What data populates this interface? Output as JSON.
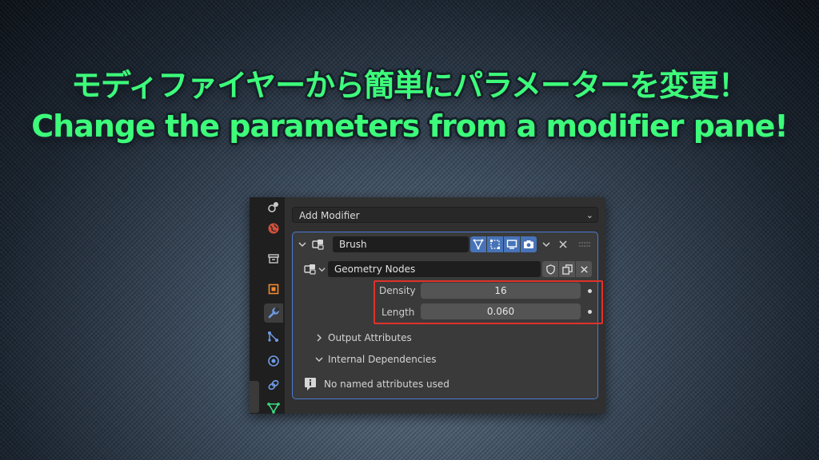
{
  "headline": {
    "jp": "モディファイヤーから簡単にパラメーターを変更！",
    "en": "Change the parameters from a modifier pane!"
  },
  "sidebar_tabs": [
    {
      "icon": "scene-data-icon",
      "color": "#c8c8c8"
    },
    {
      "icon": "world-icon",
      "color": "#e0543a"
    },
    {
      "icon": "collection-icon",
      "color": "#c8c8c8"
    },
    {
      "icon": "object-icon",
      "color": "#f0892f"
    },
    {
      "icon": "modifier-wrench-icon",
      "color": "#6f9be6",
      "active": true
    },
    {
      "icon": "particles-icon",
      "color": "#6f9be6"
    },
    {
      "icon": "physics-icon",
      "color": "#6f9be6"
    },
    {
      "icon": "constraints-icon",
      "color": "#6f9be6"
    },
    {
      "icon": "object-data-icon",
      "color": "#3ddc84"
    }
  ],
  "add_modifier": {
    "label": "Add Modifier"
  },
  "modifier": {
    "name": "Brush",
    "node_group": "Geometry Nodes",
    "inputs": [
      {
        "label": "Density",
        "value": "16"
      },
      {
        "label": "Length",
        "value": "0.060"
      }
    ],
    "output_attributes": "Output Attributes",
    "internal_dependencies": "Internal Dependencies",
    "info_message": "No named attributes used"
  },
  "colors": {
    "accent_green": "#3dfc7a",
    "panel_border": "#4b7bd1",
    "toggle_blue": "#4773b8",
    "highlight_red": "#e0312b"
  }
}
